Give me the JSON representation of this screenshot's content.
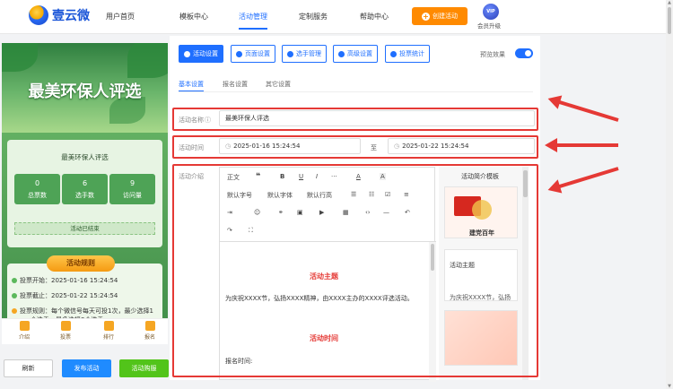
{
  "brand": {
    "name": "壹云微"
  },
  "nav": [
    "用户首页",
    "模板中心",
    "活动管理",
    "定制服务",
    "帮助中心"
  ],
  "header": {
    "create_label": "创建活动",
    "vip_badge": "VIP",
    "vip_label": "会员升级"
  },
  "phone": {
    "banner_title": "最美环保人评选",
    "card_title": "最美环保人评选",
    "stats": [
      {
        "value": "0",
        "label": "总票数"
      },
      {
        "value": "6",
        "label": "选手数"
      },
      {
        "value": "9",
        "label": "访问量"
      }
    ],
    "status": "活动已结束",
    "rules_title": "活动规则",
    "rules": [
      "投票开始：2025-01-16 15:24:54",
      "投票截止：2025-01-22 15:24:54",
      "投票规则：每个微信号每天可投1次，最少选择1",
      "个选手，最多选择3个选手"
    ],
    "tabs": [
      "介绍",
      "投票",
      "排行",
      "报名"
    ]
  },
  "buttons": {
    "refresh": "刷新",
    "publish": "发布活动",
    "buy": "活动购服"
  },
  "toolbar": [
    "活动设置",
    "页面设置",
    "选手管理",
    "高级设置",
    "投票统计"
  ],
  "preview_label": "预览效果",
  "subtabs": [
    "基本设置",
    "报名设置",
    "其它设置"
  ],
  "form": {
    "name_label": "活动名称",
    "name_value": "最美环保人评选",
    "time_label": "活动时间",
    "start": "2025-01-16 15:24:54",
    "to": "至",
    "end": "2025-01-22 15:24:54",
    "intro_label": "活动介绍"
  },
  "editor": {
    "row1": [
      "正文",
      "❝",
      "B",
      "U",
      "I",
      "···",
      "A",
      "A"
    ],
    "row2": [
      "默认字号",
      "默认字体",
      "默认行高"
    ],
    "heading1": "活动主题",
    "para1": "为庆祝XXXX节，弘扬XXXX精神，由XXXX主办的XXXX评选活动。",
    "heading2": "活动时间",
    "para2": "报名时间:"
  },
  "templates": {
    "title": "活动简介模板",
    "card1_text": "建党百年",
    "card2_title": "活动主题",
    "card2_text": "为庆祝XXXX节，弘扬"
  },
  "colors": {
    "accent": "#1f6fff",
    "orange": "#ff8a00",
    "red": "#e53935",
    "green": "#52c41a"
  }
}
